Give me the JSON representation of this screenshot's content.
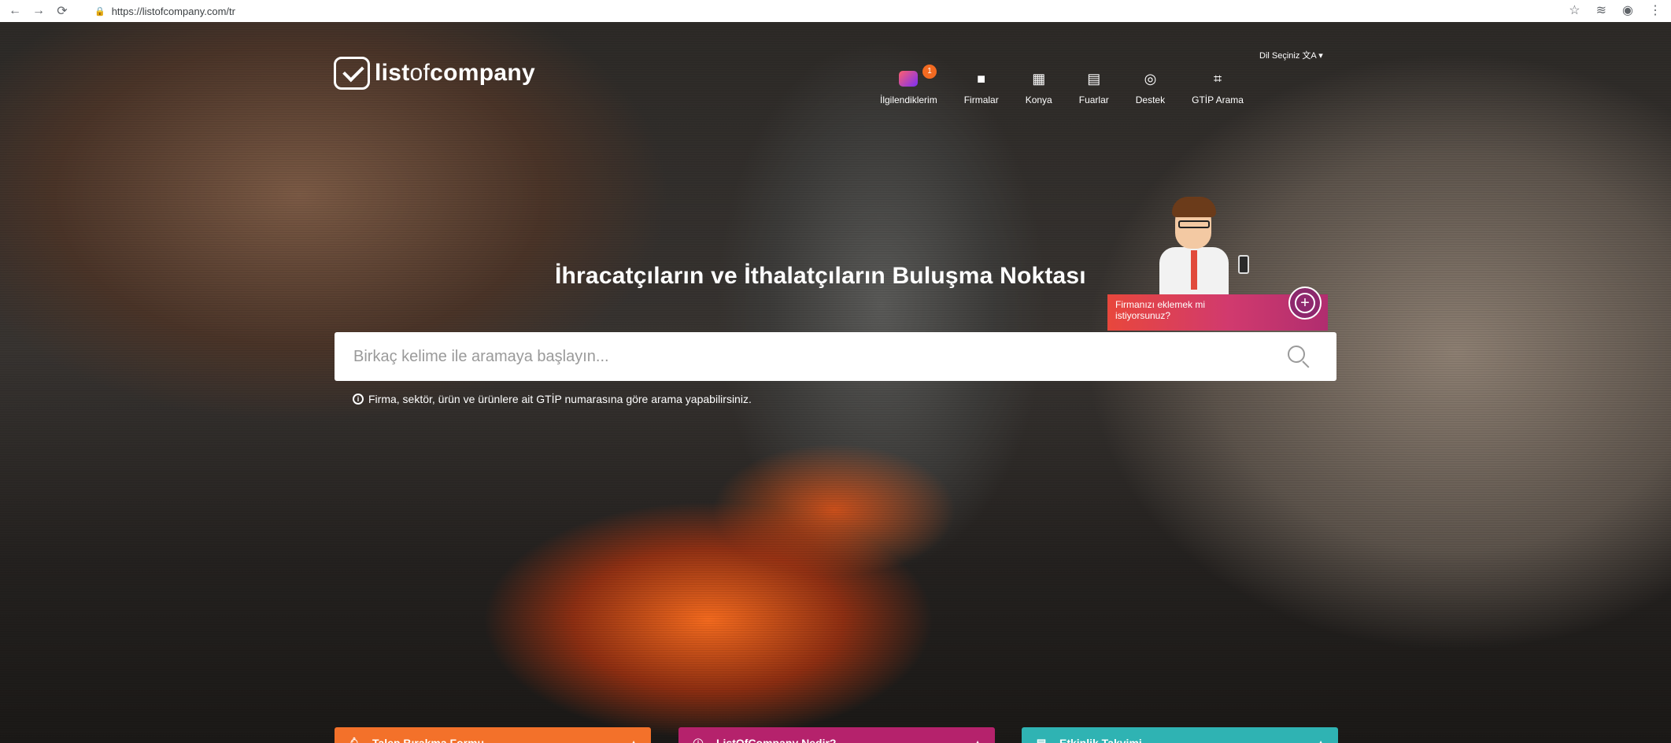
{
  "browser": {
    "url": "https://listofcompany.com/tr"
  },
  "header": {
    "logo": {
      "part1": "list",
      "part2": "of",
      "part3": "company"
    },
    "language_label": "Dil Seçiniz  文A ▾",
    "nav": [
      {
        "label": "İlgilendiklerim",
        "icon": "favorites-icon",
        "badge": "1"
      },
      {
        "label": "Firmalar",
        "icon": "briefcase-icon"
      },
      {
        "label": "Konya",
        "icon": "building-icon"
      },
      {
        "label": "Fuarlar",
        "icon": "calendar-icon"
      },
      {
        "label": "Destek",
        "icon": "support-icon"
      },
      {
        "label": "GTİP Arama",
        "icon": "scan-icon"
      }
    ]
  },
  "hero": {
    "headline": "İhracatçıların ve İthalatçıların Buluşma Noktası",
    "add_company_text": "Firmanızı eklemek mi istiyorsunuz?",
    "search": {
      "placeholder": "Birkaç kelime ile aramaya başlayın...",
      "value": ""
    },
    "hint": "Firma, sektör, ürün ve ürünlere ait GTİP numarasına göre arama yapabilirsiniz."
  },
  "bottom_tabs": [
    {
      "label": "Talep Bırakma Formu",
      "color": "#f3712a",
      "icon": "bell-icon"
    },
    {
      "label": "ListOfCompany Nedir?",
      "color": "#b5226c",
      "icon": "info-icon"
    },
    {
      "label": "Etkinlik Takvimi",
      "color": "#2fb3b3",
      "icon": "calendar-icon"
    }
  ],
  "colors": {
    "accent_orange": "#f3712a",
    "accent_magenta": "#b5226c",
    "accent_teal": "#2fb3b3"
  }
}
